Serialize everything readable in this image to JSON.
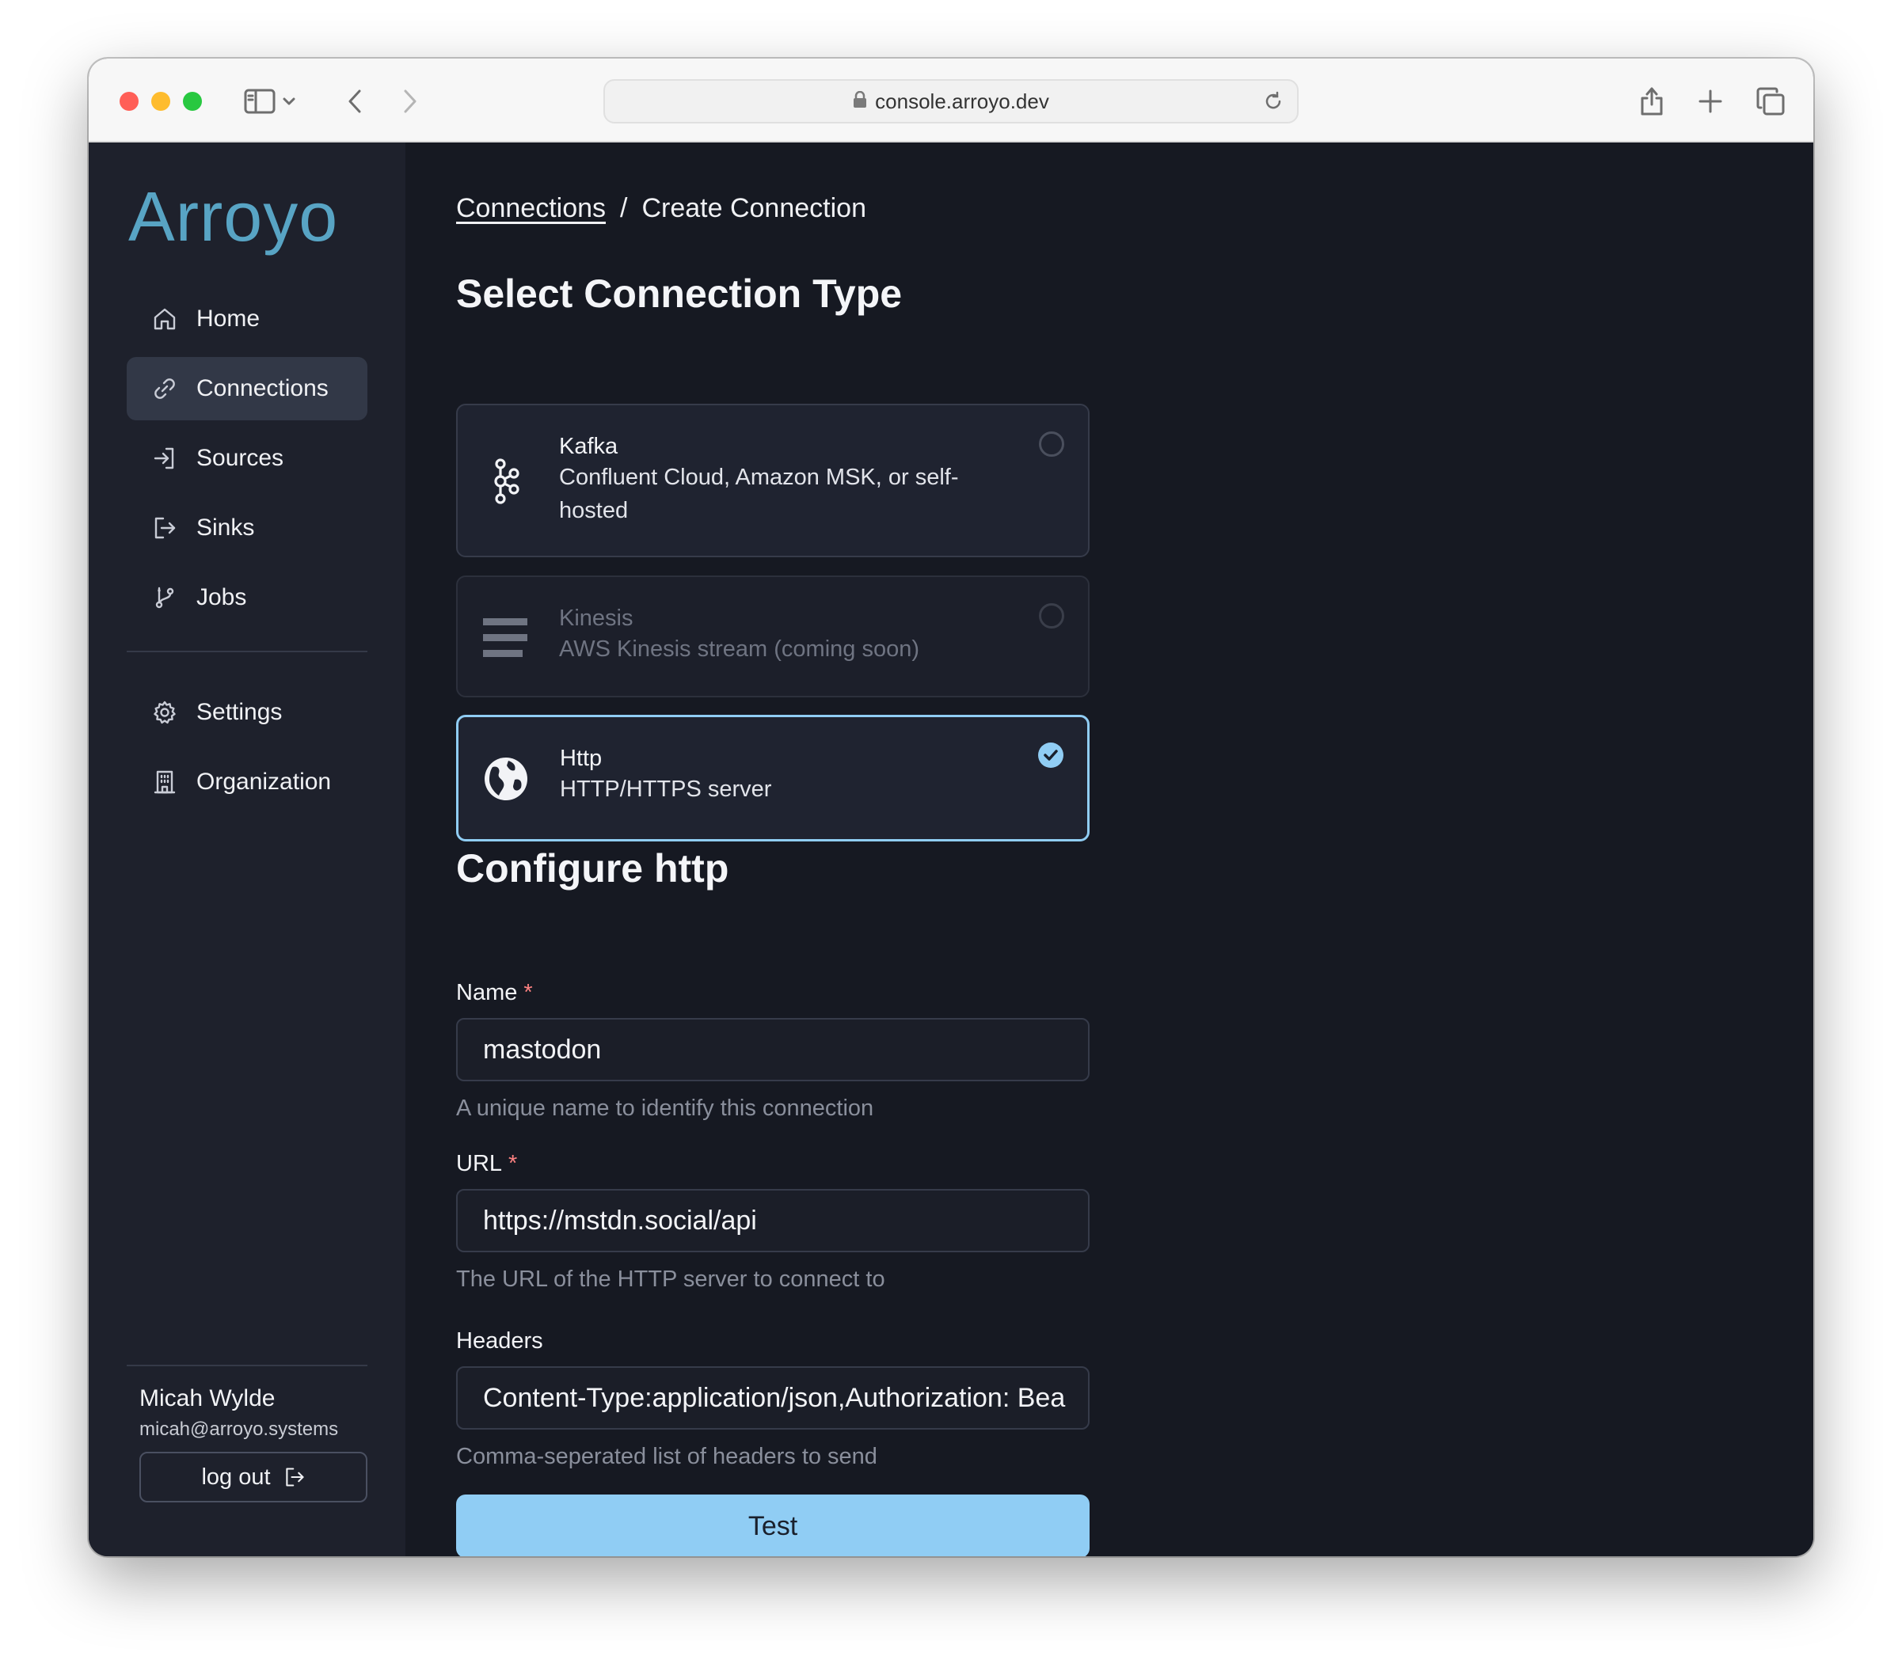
{
  "browser": {
    "url": "console.arroyo.dev"
  },
  "sidebar": {
    "logo": "Arroyo",
    "items": [
      {
        "label": "Home",
        "icon": "home-icon"
      },
      {
        "label": "Connections",
        "icon": "link-icon",
        "active": true
      },
      {
        "label": "Sources",
        "icon": "sign-in-icon"
      },
      {
        "label": "Sinks",
        "icon": "sign-out-icon"
      },
      {
        "label": "Jobs",
        "icon": "git-branch-icon"
      },
      {
        "label": "Settings",
        "icon": "gear-icon"
      },
      {
        "label": "Organization",
        "icon": "building-icon"
      }
    ],
    "user": {
      "name": "Micah Wylde",
      "email": "micah@arroyo.systems"
    },
    "logout_label": "log out"
  },
  "main": {
    "breadcrumb": {
      "link": "Connections",
      "separator": "/",
      "current": "Create Connection"
    },
    "select_title": "Select Connection Type",
    "connection_types": [
      {
        "title": "Kafka",
        "description": "Confluent Cloud, Amazon MSK, or self-hosted",
        "icon": "kafka-icon",
        "disabled": false,
        "selected": false
      },
      {
        "title": "Kinesis",
        "description": "AWS Kinesis stream (coming soon)",
        "icon": "kinesis-icon",
        "disabled": true,
        "selected": false
      },
      {
        "title": "Http",
        "description": "HTTP/HTTPS server",
        "icon": "globe-icon",
        "disabled": false,
        "selected": true
      }
    ],
    "configure_title": "Configure http",
    "fields": {
      "name": {
        "label": "Name",
        "required_mark": "*",
        "value": "mastodon",
        "help": "A unique name to identify this connection"
      },
      "url": {
        "label": "URL",
        "required_mark": "*",
        "value": "https://mstdn.social/api",
        "help": "The URL of the HTTP server to connect to"
      },
      "headers": {
        "label": "Headers",
        "value": "Content-Type:application/json,Authorization: Bea",
        "help": "Comma-seperated list of headers to send"
      }
    },
    "test_label": "Test"
  },
  "colors": {
    "accent": "#90cdf4",
    "sidebar_bg": "#1e212c",
    "main_bg": "#161922",
    "logo": "#58a4c4",
    "required": "#fc8181"
  }
}
